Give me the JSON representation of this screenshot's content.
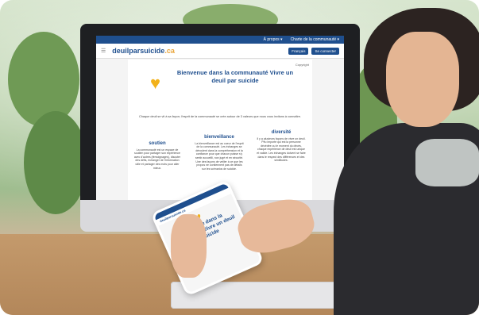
{
  "screen": {
    "topbar": {
      "link1": "À propos ▾",
      "link2": "Charte de la communauté ▾"
    },
    "logo_main": "deuilparsuicide",
    "logo_tld": ".ca",
    "nav": {
      "btn1": "Français",
      "btn2": "Se connecter"
    },
    "copyright": "Copyright",
    "welcome": "Bienvenue dans la communauté Vivre un deuil par suicide",
    "intro": "Chaque deuil se vit à sa façon; l'esprit de la communauté se crée autour de 3 valeurs que nous vous invitons à connaître.",
    "columns": [
      {
        "title": "soutien",
        "text": "La communauté est un espace de soutien pour partager son expérience avec d'autres (témoignages), discuter des défis, échanger de l'information utile et partager des mots pour aller mieux."
      },
      {
        "title": "bienveillance",
        "text": "La bienveillance est au coeur de l'esprit de la communauté. Les échanges se déroulent dans la compréhension et la confiance pour que chacun puisse s'y sentir accueilli, non jugé et en sécurité. Une des façons de veiller à ce que les propos ne contiennent pas de détails sur les scénarios de suicide."
      },
      {
        "title": "diversité",
        "text": "Il y a plusieurs façons de vivre un deuil. Peu importe qui est la personne décédée ou le moment du décès, chaque expérience de deuil est unique et valide. Les échanges doivent se faire dans le respect des différences et des similitudes."
      }
    ]
  },
  "phone": {
    "logo": "deuilparsuicide.ca",
    "welcome": "Bienvenue dans la communauté Vivre un deuil par suicide"
  },
  "colors": {
    "brand_blue": "#1f4f8e",
    "heart_yellow": "#f2b21b"
  }
}
